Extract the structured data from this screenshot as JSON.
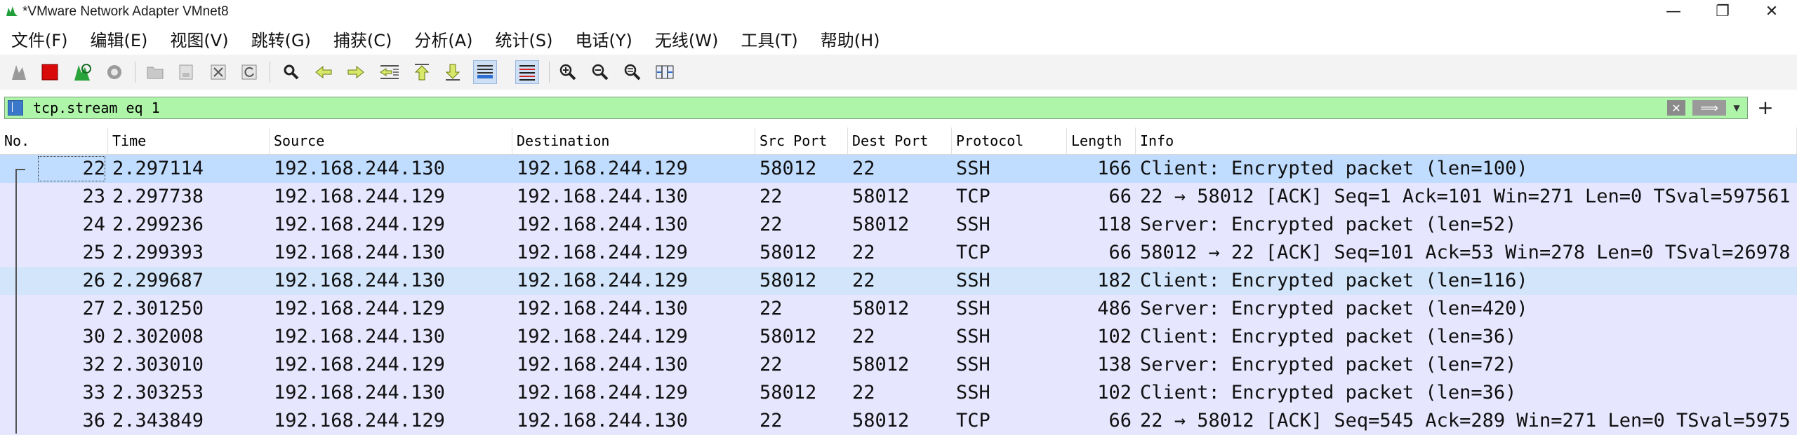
{
  "window": {
    "title": "*VMware Network Adapter VMnet8",
    "minimize": "—",
    "maximize": "❐",
    "close": "✕"
  },
  "menu": [
    "文件(F)",
    "编辑(E)",
    "视图(V)",
    "跳转(G)",
    "捕获(C)",
    "分析(A)",
    "统计(S)",
    "电话(Y)",
    "无线(W)",
    "工具(T)",
    "帮助(H)"
  ],
  "toolbar": {
    "icons": [
      "shark-fin-start-icon",
      "stop-capture-icon",
      "restart-capture-icon",
      "capture-options-icon",
      "open-file-icon",
      "save-file-icon",
      "close-file-icon",
      "reload-file-icon",
      "find-packet-icon",
      "go-back-icon",
      "go-forward-icon",
      "go-to-packet-icon",
      "first-packet-icon",
      "last-packet-icon",
      "auto-scroll-icon",
      "colorize-icon",
      "zoom-in-icon",
      "zoom-out-icon",
      "normal-size-icon",
      "resize-columns-icon"
    ]
  },
  "filter": {
    "value": "tcp.stream eq 1",
    "clear_label": "✕",
    "apply_label": "⟹",
    "dropdown_label": "▼",
    "add_label": "+"
  },
  "columns": [
    "No.",
    "Time",
    "Source",
    "Destination",
    "Src Port",
    "Dest Port",
    "Protocol",
    "Length",
    "Info"
  ],
  "packets": [
    {
      "no": "22",
      "time": "2.297114",
      "src": "192.168.244.130",
      "dst": "192.168.244.129",
      "sport": "58012",
      "dport": "22",
      "proto": "SSH",
      "len": "166",
      "info": "Client: Encrypted packet (len=100)"
    },
    {
      "no": "23",
      "time": "2.297738",
      "src": "192.168.244.129",
      "dst": "192.168.244.130",
      "sport": "22",
      "dport": "58012",
      "proto": "TCP",
      "len": "66",
      "info": "22 → 58012 [ACK] Seq=1 Ack=101 Win=271 Len=0 TSval=597561"
    },
    {
      "no": "24",
      "time": "2.299236",
      "src": "192.168.244.129",
      "dst": "192.168.244.130",
      "sport": "22",
      "dport": "58012",
      "proto": "SSH",
      "len": "118",
      "info": "Server: Encrypted packet (len=52)"
    },
    {
      "no": "25",
      "time": "2.299393",
      "src": "192.168.244.130",
      "dst": "192.168.244.129",
      "sport": "58012",
      "dport": "22",
      "proto": "TCP",
      "len": "66",
      "info": "58012 → 22 [ACK] Seq=101 Ack=53 Win=278 Len=0 TSval=26978"
    },
    {
      "no": "26",
      "time": "2.299687",
      "src": "192.168.244.130",
      "dst": "192.168.244.129",
      "sport": "58012",
      "dport": "22",
      "proto": "SSH",
      "len": "182",
      "info": "Client: Encrypted packet (len=116)"
    },
    {
      "no": "27",
      "time": "2.301250",
      "src": "192.168.244.129",
      "dst": "192.168.244.130",
      "sport": "22",
      "dport": "58012",
      "proto": "SSH",
      "len": "486",
      "info": "Server: Encrypted packet (len=420)"
    },
    {
      "no": "30",
      "time": "2.302008",
      "src": "192.168.244.130",
      "dst": "192.168.244.129",
      "sport": "58012",
      "dport": "22",
      "proto": "SSH",
      "len": "102",
      "info": "Client: Encrypted packet (len=36)"
    },
    {
      "no": "32",
      "time": "2.303010",
      "src": "192.168.244.129",
      "dst": "192.168.244.130",
      "sport": "22",
      "dport": "58012",
      "proto": "SSH",
      "len": "138",
      "info": "Server: Encrypted packet (len=72)"
    },
    {
      "no": "33",
      "time": "2.303253",
      "src": "192.168.244.130",
      "dst": "192.168.244.129",
      "sport": "58012",
      "dport": "22",
      "proto": "SSH",
      "len": "102",
      "info": "Client: Encrypted packet (len=36)"
    },
    {
      "no": "36",
      "time": "2.343849",
      "src": "192.168.244.129",
      "dst": "192.168.244.130",
      "sport": "22",
      "dport": "58012",
      "proto": "TCP",
      "len": "66",
      "info": "22 → 58012 [ACK] Seq=545 Ack=289 Win=271 Len=0 TSval=5975"
    }
  ],
  "selected_row": 0,
  "related_rows": [
    4
  ],
  "colors": {
    "row_default": "#e7e6ff",
    "row_selected": "#c0dcff",
    "row_related": "#d2e5fb",
    "filter_valid": "#aff5a9"
  }
}
